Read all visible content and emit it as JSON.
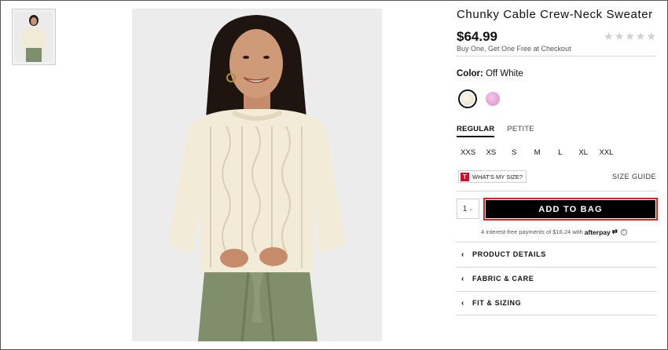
{
  "product": {
    "title": "Chunky Cable Crew-Neck Sweater",
    "price": "$64.99",
    "promo": "Buy One, Get One Free at Checkout",
    "rating_stars": 0,
    "rating_max": 5
  },
  "color": {
    "label": "Color:",
    "selected_name": "Off White",
    "swatches": [
      {
        "name": "Off White",
        "hex": "#f2eddc",
        "selected": true
      },
      {
        "name": "Pink",
        "hex": "#e9a6d8",
        "selected": false
      }
    ]
  },
  "fit": {
    "tabs": [
      {
        "label": "REGULAR",
        "active": true
      },
      {
        "label": "PETITE",
        "active": false
      }
    ]
  },
  "sizes": [
    "XXS",
    "XS",
    "S",
    "M",
    "L",
    "XL",
    "XXL"
  ],
  "size_help": {
    "whats_my_size_icon": "T",
    "whats_my_size": "WHAT'S MY SIZE?",
    "size_guide": "SIZE GUIDE"
  },
  "purchase": {
    "quantity": "1",
    "add_to_bag": "ADD TO BAG",
    "afterpay_text": "4 interest-free payments of $16.24 with",
    "afterpay_logo": "afterpay",
    "afterpay_logo_mark": "⇄",
    "afterpay_info": "i"
  },
  "accordions": [
    {
      "label": "PRODUCT DETAILS"
    },
    {
      "label": "FABRIC & CARE"
    },
    {
      "label": "FIT & SIZING"
    }
  ],
  "colors": {
    "accent_border": "#e0201e",
    "button_bg": "#000000",
    "tag_red": "#c8102e",
    "star_empty": "#cfcfcf"
  },
  "icons": {
    "star": "star-empty-icon",
    "chevron": "chevron-left-icon",
    "dropdown": "chevron-down-icon"
  }
}
